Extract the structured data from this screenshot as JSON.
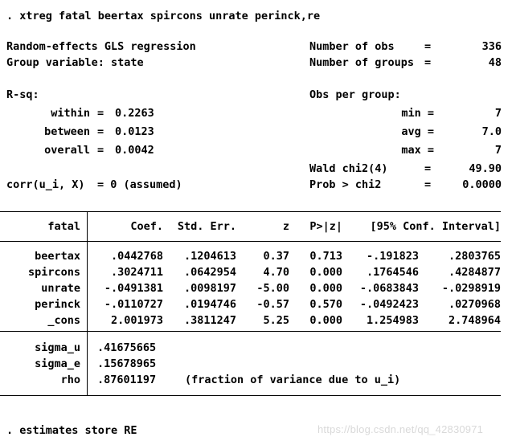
{
  "command_top": ". xtreg fatal beertax spircons unrate perinck,re",
  "command_bottom": ". estimates store RE",
  "header": {
    "model_title": "Random-effects GLS regression",
    "group_variable_label": "Group variable: state",
    "rsq_label": "R-sq:",
    "rsq_rows": [
      {
        "label": "within",
        "eq": "=",
        "value": "0.2263"
      },
      {
        "label": "between",
        "eq": "=",
        "value": "0.0123"
      },
      {
        "label": "overall",
        "eq": "=",
        "value": "0.0042"
      }
    ],
    "corr_label": "corr(u_i, X)",
    "corr_value": "= 0 (assumed)",
    "stats_right": [
      {
        "label": "Number of obs",
        "eq": "=",
        "value": "336"
      },
      {
        "label": "Number of groups",
        "eq": "=",
        "value": "48"
      }
    ],
    "obs_per_group_label": "Obs per group:",
    "obs_per_group": [
      {
        "label": "min =",
        "value": "7"
      },
      {
        "label": "avg =",
        "value": "7.0"
      },
      {
        "label": "max =",
        "value": "7"
      }
    ],
    "tests": [
      {
        "label": "Wald chi2(4)",
        "eq": "=",
        "value": "49.90"
      },
      {
        "label": "Prob > chi2",
        "eq": "=",
        "value": "0.0000"
      }
    ]
  },
  "table": {
    "depvar": "fatal",
    "columns": [
      "Coef.",
      "Std. Err.",
      "z",
      "P>|z|"
    ],
    "ci_header": "[95% Conf. Interval]",
    "rows": [
      {
        "term": "beertax",
        "coef": ".0442768",
        "se": ".1204613",
        "z": "0.37",
        "p": "0.713",
        "ci_low": "-.191823",
        "ci_high": ".2803765"
      },
      {
        "term": "spircons",
        "coef": ".3024711",
        "se": ".0642954",
        "z": "4.70",
        "p": "0.000",
        "ci_low": ".1764546",
        "ci_high": ".4284877"
      },
      {
        "term": "unrate",
        "coef": "-.0491381",
        "se": ".0098197",
        "z": "-5.00",
        "p": "0.000",
        "ci_low": "-.0683843",
        "ci_high": "-.0298919"
      },
      {
        "term": "perinck",
        "coef": "-.0110727",
        "se": ".0194746",
        "z": "-0.57",
        "p": "0.570",
        "ci_low": "-.0492423",
        "ci_high": ".0270968"
      },
      {
        "term": "_cons",
        "coef": "2.001973",
        "se": ".3811247",
        "z": "5.25",
        "p": "0.000",
        "ci_low": "1.254983",
        "ci_high": "2.748964"
      }
    ],
    "variance_rows": [
      {
        "term": "sigma_u",
        "value": ".41675665",
        "note": ""
      },
      {
        "term": "sigma_e",
        "value": ".15678965",
        "note": ""
      },
      {
        "term": "rho",
        "value": ".87601197",
        "note": "(fraction of variance due to u_i)"
      }
    ]
  },
  "watermark": "https://blog.csdn.net/qq_42830971"
}
